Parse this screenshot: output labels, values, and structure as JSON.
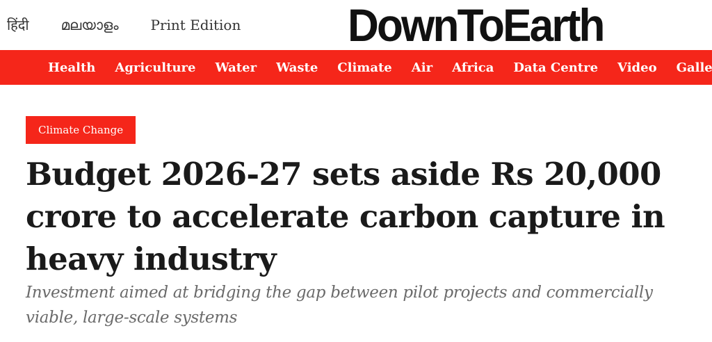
{
  "header": {
    "lang_hindi": "हिंदी",
    "lang_malayalam": "മലയാളം",
    "print_edition": "Print Edition",
    "logo_text": "DownToEarth"
  },
  "nav": {
    "items": [
      {
        "label": "Health"
      },
      {
        "label": "Agriculture"
      },
      {
        "label": "Water"
      },
      {
        "label": "Waste"
      },
      {
        "label": "Climate"
      },
      {
        "label": "Air"
      },
      {
        "label": "Africa"
      },
      {
        "label": "Data Centre"
      },
      {
        "label": "Video"
      },
      {
        "label": "Gallery",
        "has_dropdown": true,
        "icon": "chevron-down-icon"
      }
    ]
  },
  "article": {
    "category": "Climate Change",
    "headline": "Budget 2026-27 sets aside Rs 20,000 crore to accelerate carbon capture in heavy industry",
    "subheadline": "Investment aimed at bridging the gap between pilot projects and commercially viable, large-scale systems"
  },
  "colors": {
    "brand_red": "#f5261a",
    "headline": "#1a1a1a",
    "subheadline": "#6a6a6a"
  }
}
